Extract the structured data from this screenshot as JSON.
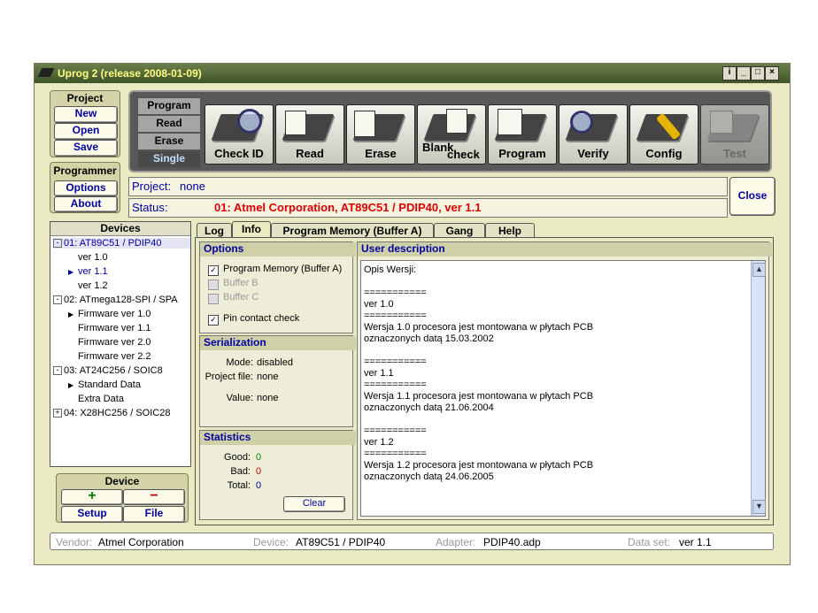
{
  "window": {
    "title": "Uprog 2 (release 2008-01-09)",
    "buttons": [
      "i",
      "_",
      "□",
      "×"
    ]
  },
  "project": {
    "title": "Project",
    "new": "New",
    "open": "Open",
    "save": "Save"
  },
  "programmer": {
    "title": "Programmer",
    "options": "Options",
    "about": "About"
  },
  "modes": [
    "Program",
    "Read",
    "Erase",
    "Single"
  ],
  "tools": [
    "Check ID",
    "Read",
    "Erase",
    "Blank check",
    "Program",
    "Verify",
    "Config",
    "Test"
  ],
  "tools_blank": {
    "a": "Blank",
    "b": "check"
  },
  "status_panel": {
    "project_label": "Project:",
    "project_value": "none",
    "status_label": "Status:",
    "status_value": "01: Atmel Corporation, AT89C51 / PDIP40, ver 1.1",
    "close": "Close"
  },
  "devices": {
    "title": "Devices",
    "items": [
      {
        "text": "01: AT89C51 / PDIP40",
        "type": "group",
        "exp": "-"
      },
      {
        "text": "ver 1.0",
        "type": "leaf"
      },
      {
        "text": "ver 1.1",
        "type": "leaf",
        "arrow": true
      },
      {
        "text": "ver 1.2",
        "type": "leaf"
      },
      {
        "text": "02: ATmega128-SPI / SPA",
        "type": "group",
        "exp": "-"
      },
      {
        "text": "Firmware ver 1.0",
        "type": "leaf",
        "arrow": true
      },
      {
        "text": "Firmware ver 1.1",
        "type": "leaf"
      },
      {
        "text": "Firmware ver 2.0",
        "type": "leaf"
      },
      {
        "text": "Firmware ver 2.2",
        "type": "leaf"
      },
      {
        "text": "03: AT24C256 / SOIC8",
        "type": "group",
        "exp": "-"
      },
      {
        "text": "Standard Data",
        "type": "leaf",
        "arrow": true
      },
      {
        "text": "Extra Data",
        "type": "leaf"
      },
      {
        "text": "04: X28HC256 / SOIC28",
        "type": "group",
        "exp": "+"
      }
    ]
  },
  "device_box": {
    "title": "Device",
    "add": "+",
    "remove": "−",
    "setup": "Setup",
    "file": "File"
  },
  "tabs": [
    "Log",
    "Info",
    "Program Memory (Buffer A)",
    "Gang",
    "Help"
  ],
  "options": {
    "title": "Options",
    "items": [
      {
        "label": "Program Memory (Buffer A)",
        "checked": "✓",
        "enabled": true
      },
      {
        "label": "Buffer B",
        "checked": "",
        "enabled": false
      },
      {
        "label": "Buffer C",
        "checked": "",
        "enabled": false
      },
      {
        "label": "Pin contact check",
        "checked": "✓",
        "enabled": true
      }
    ]
  },
  "serialization": {
    "title": "Serialization",
    "mode_label": "Mode:",
    "mode_value": "disabled",
    "file_label": "Project file:",
    "file_value": "none",
    "value_label": "Value:",
    "value_value": "none"
  },
  "statistics": {
    "title": "Statistics",
    "good_label": "Good:",
    "good_value": "0",
    "bad_label": "Bad:",
    "bad_value": "0",
    "total_label": "Total:",
    "total_value": "0",
    "clear": "Clear"
  },
  "user_description": {
    "title": "User description",
    "text": "Opis Wersji:\n\n===========\nver 1.0\n===========\nWersja 1.0 procesora jest montowana w płytach PCB\noznaczonych datą 15.03.2002\n\n===========\nver 1.1\n===========\nWersja 1.1 procesora jest montowana w płytach PCB\noznaczonych datą 21.06.2004\n\n===========\nver 1.2\n===========\nWersja 1.2 procesora jest montowana w płytach PCB\noznaczonych datą 24.06.2005"
  },
  "statusbar": {
    "vendor_label": "Vendor:",
    "vendor_value": "Atmel Corporation",
    "device_label": "Device:",
    "device_value": "AT89C51 / PDIP40",
    "adapter_label": "Adapter:",
    "adapter_value": "PDIP40.adp",
    "dataset_label": "Data set:",
    "dataset_value": "ver 1.1"
  },
  "colors": {
    "accent": "#0000a0",
    "status_red": "#dd0000",
    "stat_green": "#008000",
    "stat_red": "#c00000",
    "background": "#eaeac2"
  }
}
